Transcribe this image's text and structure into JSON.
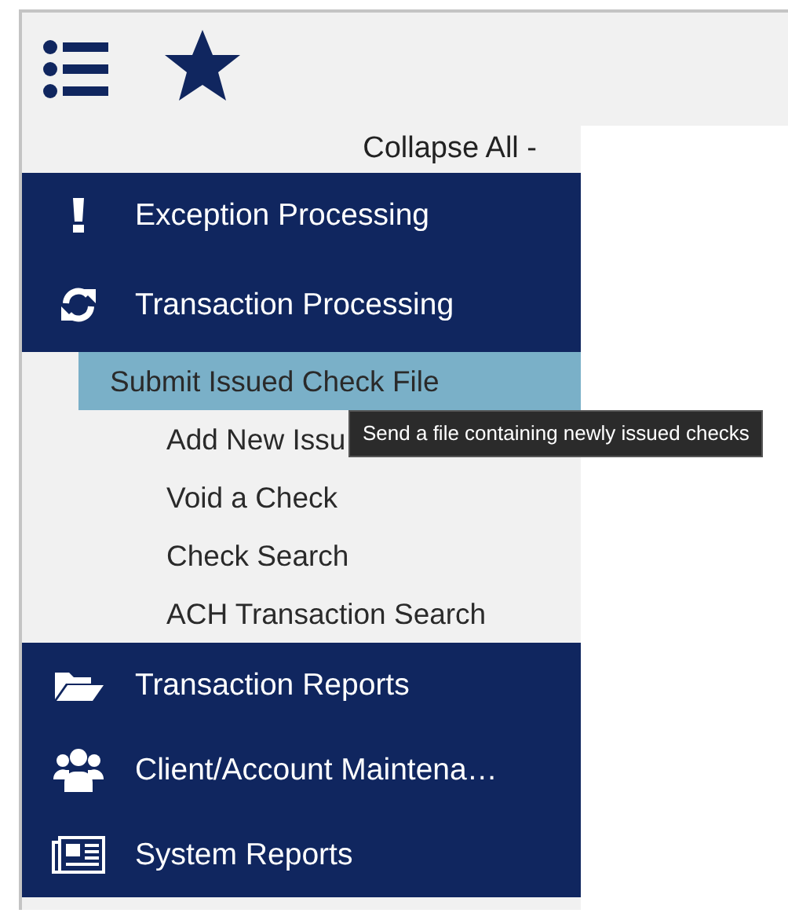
{
  "toolbar": {
    "buttons": [
      {
        "kind": "list"
      },
      {
        "kind": "favorites"
      }
    ]
  },
  "sidebar": {
    "collapse_all": "Collapse All -",
    "items": [
      {
        "label": "Exception Processing"
      },
      {
        "label": "Transaction Processing",
        "expanded": true,
        "children": [
          {
            "label": "Submit Issued Check File",
            "selected": true
          },
          {
            "label": "Add New Issu",
            "selected": false
          },
          {
            "label": "Void a Check",
            "selected": false
          },
          {
            "label": "Check Search",
            "selected": false
          },
          {
            "label": "ACH Transaction Search",
            "selected": false
          }
        ]
      },
      {
        "label": "Transaction Reports"
      },
      {
        "label": "Client/Account Maintena…"
      },
      {
        "label": "System Reports"
      }
    ]
  },
  "tooltip": "Send a file containing newly issued checks"
}
